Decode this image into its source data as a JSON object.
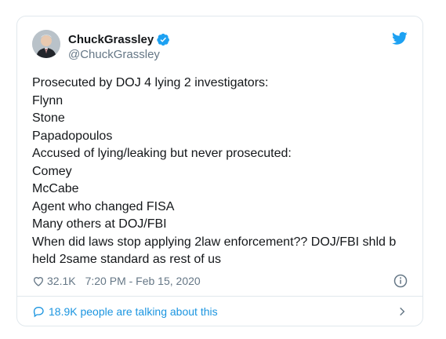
{
  "user": {
    "display_name": "ChuckGrassley",
    "handle": "@ChuckGrassley"
  },
  "tweet": {
    "lines": [
      "Prosecuted by DOJ 4 lying 2 investigators:",
      "Flynn",
      "Stone",
      "Papadopoulos",
      "Accused of lying/leaking but never prosecuted:",
      "Comey",
      "McCabe",
      "Agent who changed FISA",
      "Many others at DOJ/FBI",
      "When did laws stop applying 2law enforcement?? DOJ/FBI shld b",
      "held 2same standard as rest of us"
    ]
  },
  "meta": {
    "likes": "32.1K",
    "timestamp": "7:20 PM - Feb 15, 2020"
  },
  "footer": {
    "conversation": "18.9K people are talking about this"
  },
  "icons": {
    "verified": "verified-badge-icon",
    "brand": "twitter-bird-icon",
    "like": "heart-icon",
    "info": "info-icon",
    "conversation": "speech-bubble-icon",
    "chevron": "chevron-right-icon"
  },
  "colors": {
    "brand_blue": "#1da1f2",
    "link_blue": "#1b95e0",
    "secondary_text": "#657786",
    "border": "#e1e8ed"
  }
}
